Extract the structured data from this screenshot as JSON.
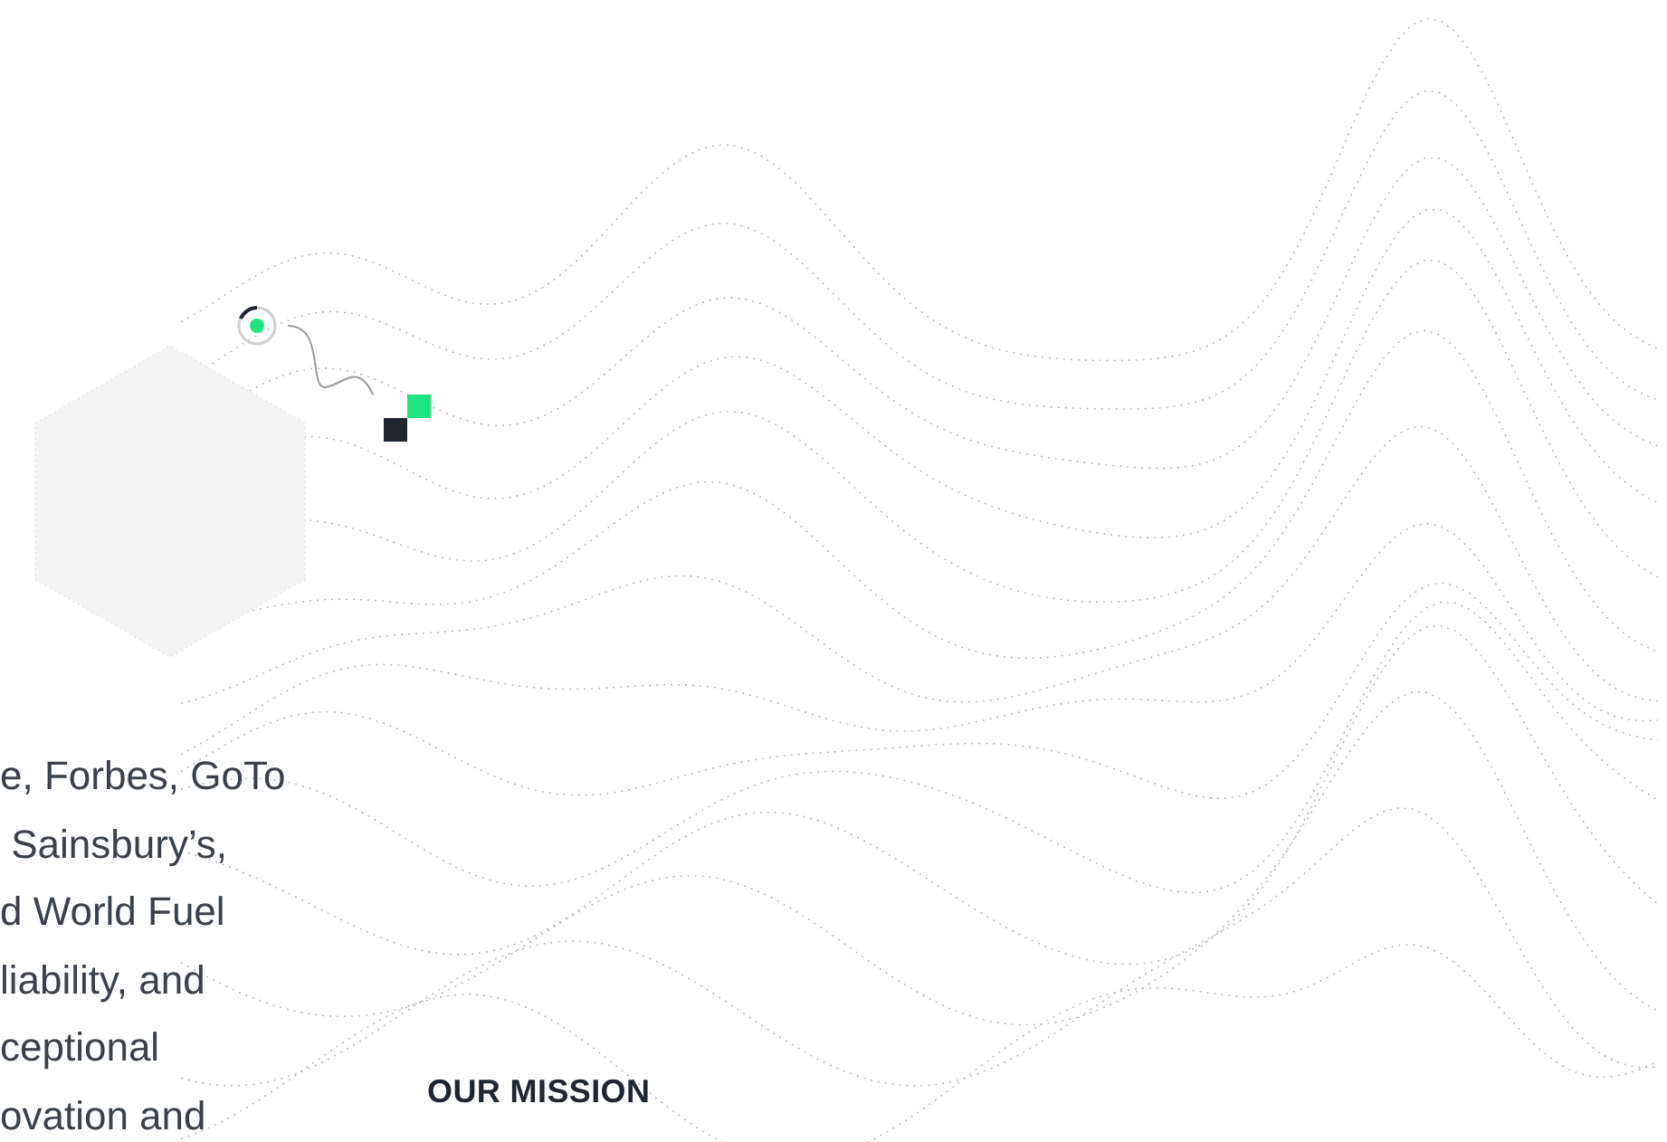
{
  "intro": {
    "lines": [
      "e, Forbes, GoTo",
      " Sainsbury’s,",
      "d World Fuel",
      "liability, and",
      "ceptional",
      "ovation and"
    ]
  },
  "section_label": "OUR MISSION"
}
